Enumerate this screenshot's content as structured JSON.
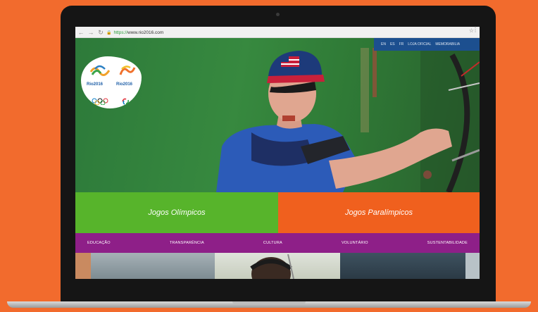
{
  "browser": {
    "back_icon": "arrow-left-icon",
    "forward_icon": "arrow-right-icon",
    "reload_icon": "reload-icon",
    "url_scheme": "https://",
    "url_host": "www.rio2016.com",
    "bookmark_icon": "star-icon"
  },
  "top_strip": {
    "items": [
      "EN",
      "ES",
      "FR",
      "LOJA OFICIAL",
      "MEMORABILIA"
    ]
  },
  "logos": {
    "olympic_text": "Rio2016",
    "paralympic_text": "Rio2016"
  },
  "buttons": {
    "olympic": "Jogos Olímpicos",
    "paralympic": "Jogos Paralímpicos"
  },
  "menu": {
    "items": [
      "EDUCAÇÃO",
      "TRANSPARÊNCIA",
      "CULTURA",
      "VOLUNTÁRIO",
      "SUSTENTABILIDADE"
    ]
  },
  "colors": {
    "background": "#f26b2d",
    "olympic_green": "#57b42b",
    "paralympic_orange": "#f0601e",
    "menu_purple": "#8e1f88",
    "top_strip_blue": "#1c4f8f"
  }
}
